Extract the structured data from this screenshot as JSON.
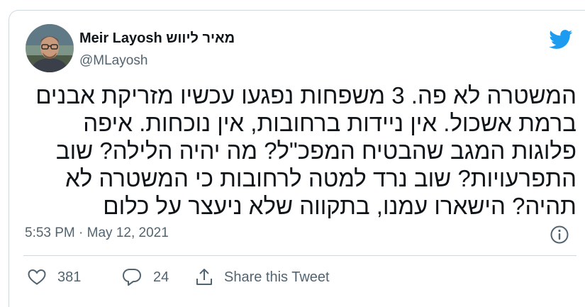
{
  "author": {
    "display_name": "Meir Layosh מאיר ליווש",
    "handle": "@MLayosh",
    "avatar_icon": "profile-photo"
  },
  "tweet": {
    "text": "המשטרה לא פה. 3 משפחות נפגעו עכשיו מזריקת אבנים ברמת אשכול. אין ניידות ברחובות, אין נוכחות. איפה פלוגות המגב שהבטיח המפכ\"ל? מה יהיה הלילה? שוב התפרעויות? שוב נרד למטה לרחובות כי המשטרה לא תהיה? הישארו עמנו, בתקווה שלא ניעצר על כלום",
    "timestamp": "5:53 PM · May 12, 2021"
  },
  "actions": {
    "like_count": "381",
    "reply_count": "24",
    "share_label": "Share this Tweet"
  },
  "icons": {
    "brand": "twitter-bird-icon",
    "info": "info-icon",
    "like": "heart-icon",
    "reply": "reply-bubble-icon",
    "share": "share-upload-icon"
  },
  "colors": {
    "brand_blue": "#1d9bf0",
    "text_primary": "#0f1419",
    "text_secondary": "#536471",
    "border": "#cfd9de"
  }
}
